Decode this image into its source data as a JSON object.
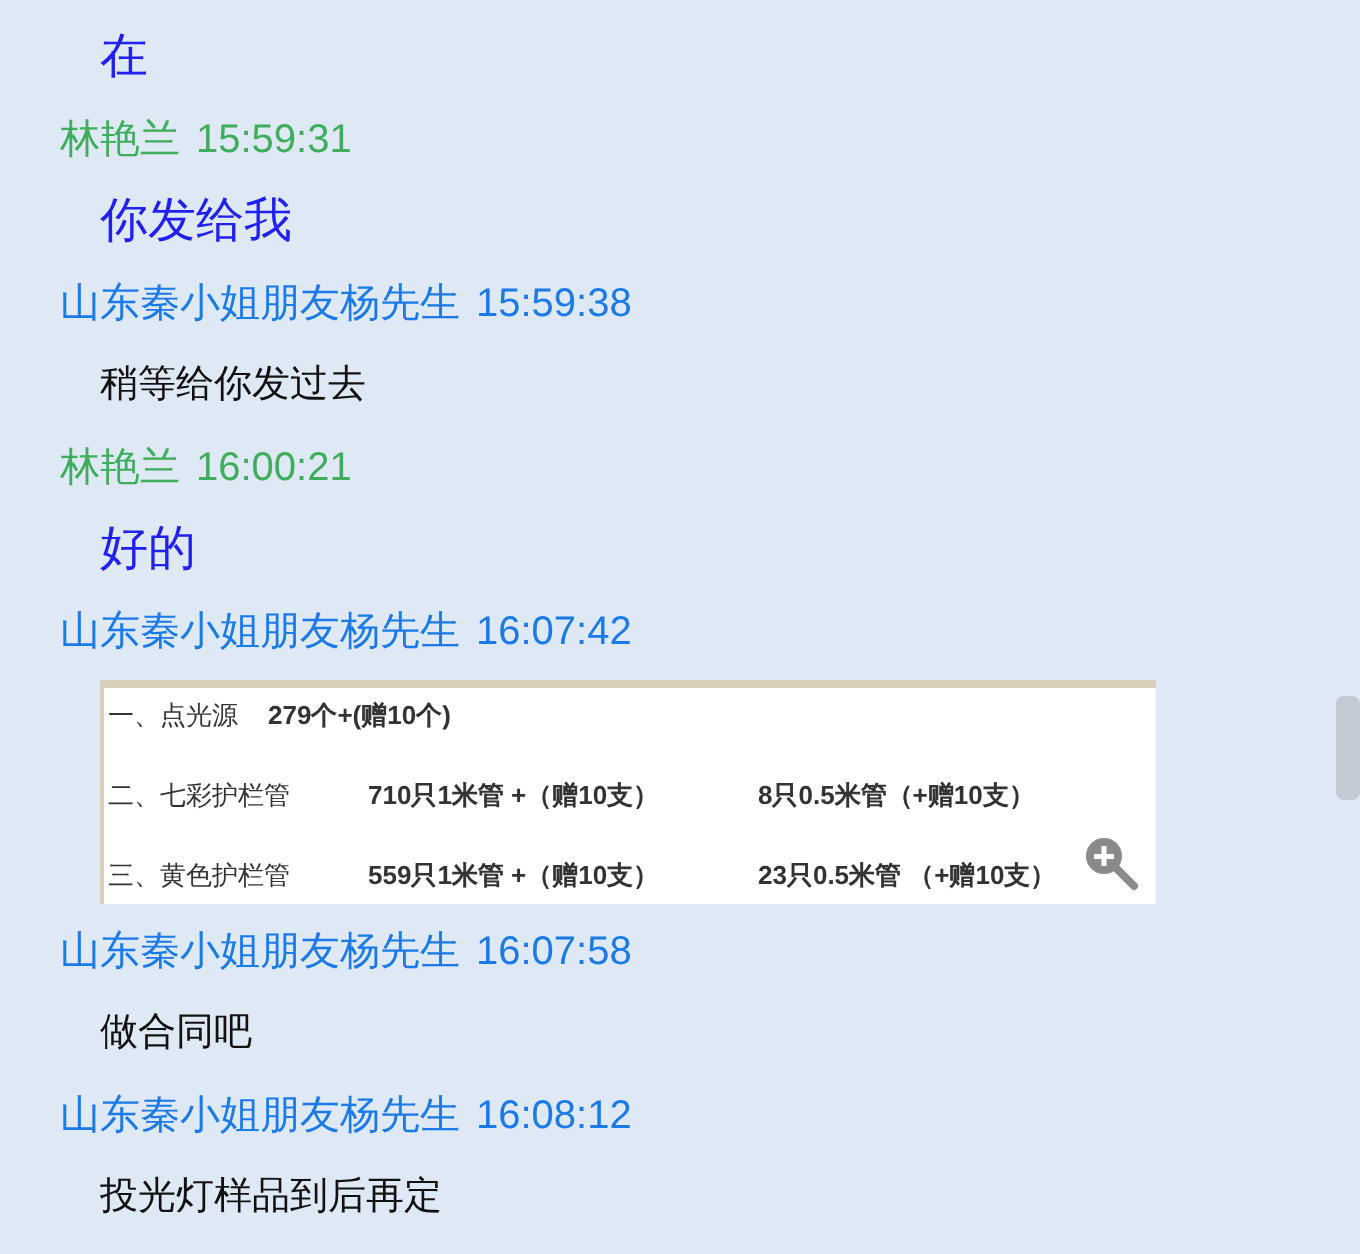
{
  "messages": [
    {
      "kind": "text",
      "own": true,
      "text": "在"
    },
    {
      "kind": "header",
      "own": true,
      "sender": "林艳兰",
      "time": "15:59:31"
    },
    {
      "kind": "text",
      "own": true,
      "text": "你发给我"
    },
    {
      "kind": "header",
      "own": false,
      "sender": "山东秦小姐朋友杨先生",
      "time": "15:59:38"
    },
    {
      "kind": "text",
      "own": false,
      "text": "稍等给你发过去"
    },
    {
      "kind": "header",
      "own": true,
      "sender": "林艳兰",
      "time": "16:00:21"
    },
    {
      "kind": "text",
      "own": true,
      "text": "好的"
    },
    {
      "kind": "header",
      "own": false,
      "sender": "山东秦小姐朋友杨先生",
      "time": "16:07:42"
    },
    {
      "kind": "image",
      "lines": [
        [
          "一、点光源",
          "279个+(赠10个)"
        ],
        [
          "二、七彩护栏管",
          "710只1米管 +（赠10支）",
          "8只0.5米管（+赠10支）"
        ],
        [
          "三、黄色护栏管",
          "559只1米管 +（赠10支）",
          "23只0.5米管 （+赠10支）"
        ]
      ]
    },
    {
      "kind": "header",
      "own": false,
      "sender": "山东秦小姐朋友杨先生",
      "time": "16:07:58"
    },
    {
      "kind": "text",
      "own": false,
      "text": "做合同吧"
    },
    {
      "kind": "header",
      "own": false,
      "sender": "山东秦小姐朋友杨先生",
      "time": "16:08:12"
    },
    {
      "kind": "text",
      "own": false,
      "text": "投光灯样品到后再定"
    }
  ]
}
